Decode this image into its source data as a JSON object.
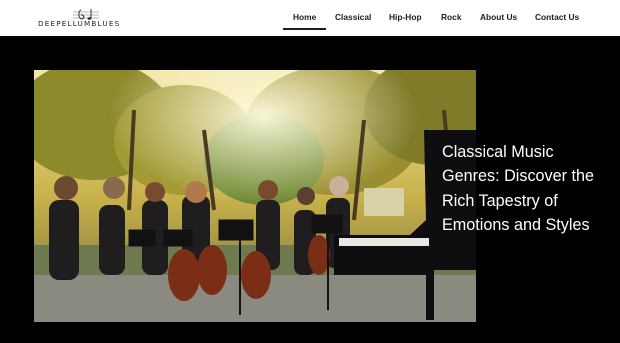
{
  "brand": {
    "name": "DEEPELLUMBLUES",
    "logo_icon": "music-note-staff-icon"
  },
  "nav": {
    "items": [
      {
        "label": "Home",
        "active": true
      },
      {
        "label": "Classical"
      },
      {
        "label": "Hip-Hop"
      },
      {
        "label": "Rock"
      },
      {
        "label": "About Us"
      },
      {
        "label": "Contact Us"
      }
    ]
  },
  "hero": {
    "title": "Classical Music Genres: Discover the Rich Tapestry of Emotions and Styles"
  },
  "colors": {
    "header_bg": "#ffffff",
    "page_bg": "#000000",
    "text_dark": "#1e1e1e",
    "title_color": "#ffffff"
  }
}
